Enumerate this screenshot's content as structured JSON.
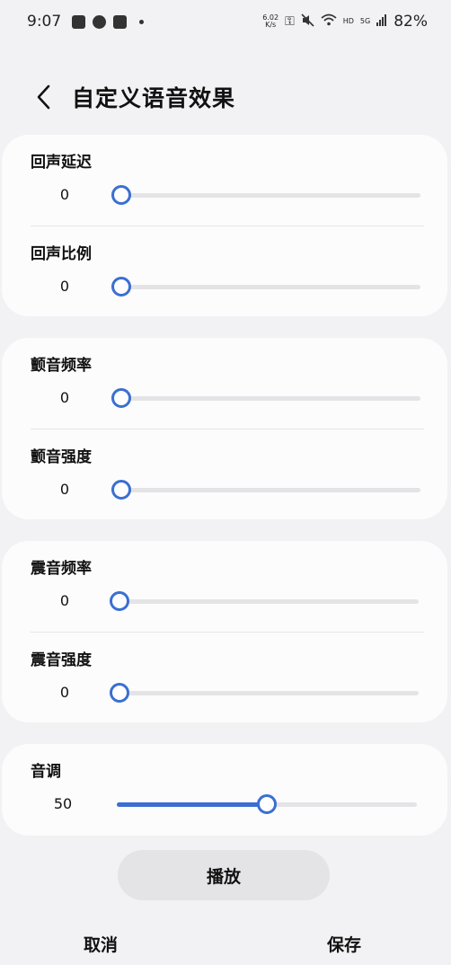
{
  "status_bar": {
    "time": "9:07",
    "net_speed_value": "6.02",
    "net_speed_unit": "K/s",
    "hd_label": "HD",
    "network_label": "5G",
    "battery": "82%"
  },
  "header": {
    "title": "自定义语音效果"
  },
  "sections": [
    {
      "rows": [
        {
          "label": "回声延迟",
          "value": "0",
          "level": 0
        },
        {
          "label": "回声比例",
          "value": "0",
          "level": 0
        }
      ]
    },
    {
      "rows": [
        {
          "label": "颤音频率",
          "value": "0",
          "level": 0
        },
        {
          "label": "颤音强度",
          "value": "0",
          "level": 0
        }
      ]
    },
    {
      "rows": [
        {
          "label": "震音频率",
          "value": "0",
          "level": 0
        },
        {
          "label": "震音强度",
          "value": "0",
          "level": 0
        }
      ]
    },
    {
      "rows": [
        {
          "label": "音调",
          "value": "50",
          "level": 0.5
        }
      ]
    }
  ],
  "actions": {
    "play_label": "播放",
    "cancel_label": "取消",
    "save_label": "保存"
  },
  "colors": {
    "accent": "#3b6fd1",
    "track": "#e4e4e6"
  }
}
